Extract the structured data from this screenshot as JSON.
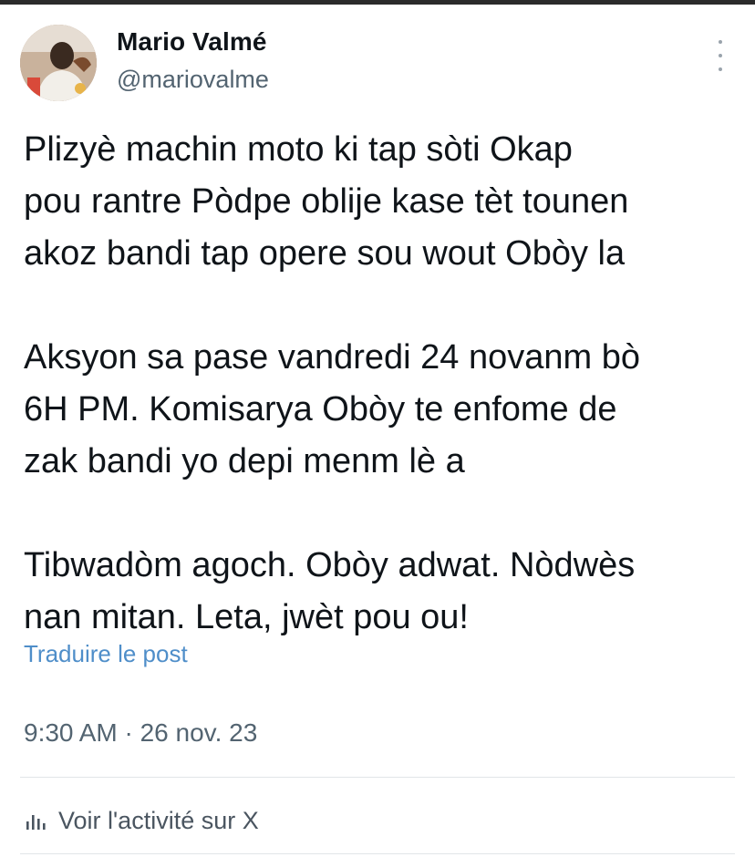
{
  "post": {
    "author": {
      "name": "Mario Valmé",
      "handle": "@mariovalme"
    },
    "paragraphs": [
      "Plizyè machin moto ki tap sòti Okap\npou rantre Pòdpe oblije kase tèt tounen\nakoz bandi tap opere sou wout Obòy la",
      "Aksyon sa pase vandredi 24 novanm bò\n6H PM. Komisarya Obòy te enfome de\nzak bandi yo depi menm lè a",
      "Tibwadòm agoch. Obòy adwat. Nòdwès\nnan mitan. Leta, jwèt pou ou!"
    ],
    "translate_label": "Traduire le post",
    "timestamp": "9:30 AM · 26 nov. 23",
    "activity_label": "Voir l'activité sur X"
  },
  "icons": {
    "more": "more-vertical-icon",
    "activity": "bar-chart-icon"
  },
  "colors": {
    "text": "#0f1419",
    "muted": "#536471",
    "link": "#4f8ec9",
    "divider": "#e1e5e8"
  }
}
